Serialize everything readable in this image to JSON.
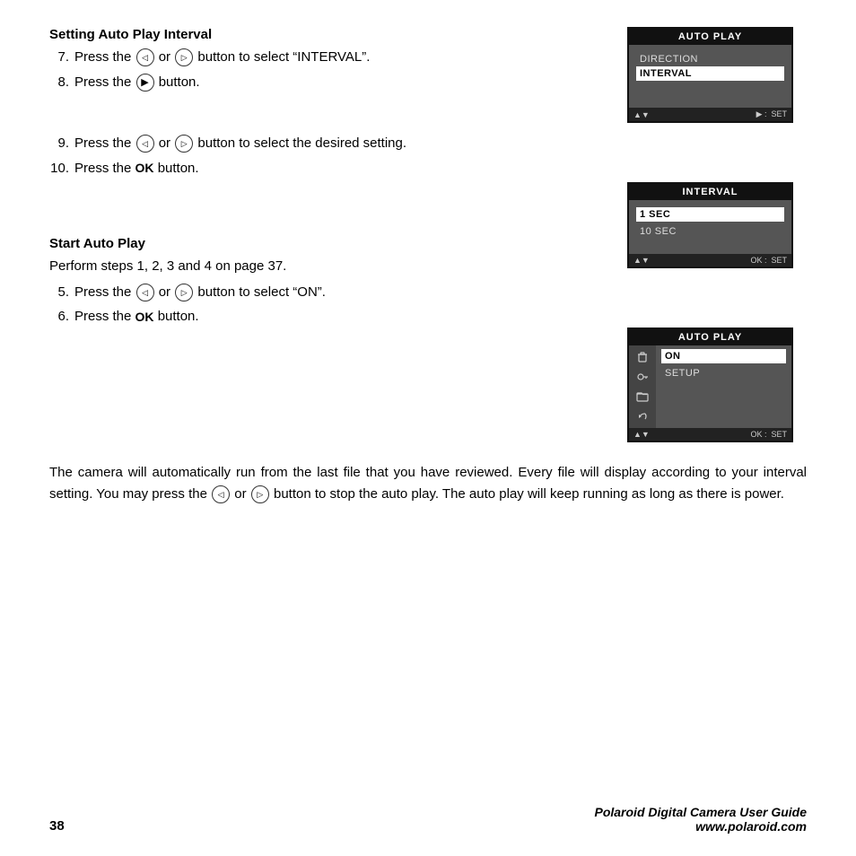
{
  "page": {
    "number": "38",
    "footer_brand_line1": "Polaroid Digital Camera User Guide",
    "footer_brand_line2": "www.polaroid.com"
  },
  "section1": {
    "heading": "Setting Auto Play Interval",
    "steps": [
      {
        "num": "7.",
        "text_before": "Press the",
        "or": "or",
        "text_after": "button to select “INTERVAL”."
      },
      {
        "num": "8.",
        "text_before": "Press the",
        "text_after": "button."
      }
    ],
    "steps2": [
      {
        "num": "9.",
        "text_before": "Press the",
        "or": "or",
        "text_after": "button to select the desired setting."
      },
      {
        "num": "10.",
        "text_before": "Press the",
        "ok_label": "OK",
        "text_after": "button."
      }
    ]
  },
  "section2": {
    "heading": "Start Auto Play",
    "intro": "Perform steps 1, 2, 3 and 4 on page 37.",
    "steps": [
      {
        "num": "5.",
        "text_before": "Press the",
        "or": "or",
        "text_after": "button to select “ON”."
      },
      {
        "num": "6.",
        "text_before": "Press the",
        "ok_label": "OK",
        "text_after": "button."
      }
    ]
  },
  "bottom_text": "The camera will automatically run from the last file that you have reviewed. Every file will display according to your interval setting. You may press the",
  "bottom_text2": "or",
  "bottom_text3": "button to stop the auto play. The auto play will keep running as long as there is power.",
  "screens": {
    "screen1": {
      "title": "AUTO PLAY",
      "items": [
        "DIRECTION",
        "INTERVAL"
      ],
      "selected": "INTERVAL",
      "footer_left": "▲▼",
      "footer_right": "► :  SET"
    },
    "screen2": {
      "title": "INTERVAL",
      "items": [
        "1 SEC",
        "10 SEC"
      ],
      "selected": "1 SEC",
      "footer_left": "▲▼",
      "footer_right": "OK :  SET"
    },
    "screen3": {
      "title": "AUTO PLAY",
      "icons": [
        "🗑",
        "🔑",
        "🗂",
        "↶"
      ],
      "items": [
        "ON",
        "SETUP"
      ],
      "selected": "ON",
      "footer_left": "▲▼",
      "footer_right": "OK :  SET"
    }
  }
}
